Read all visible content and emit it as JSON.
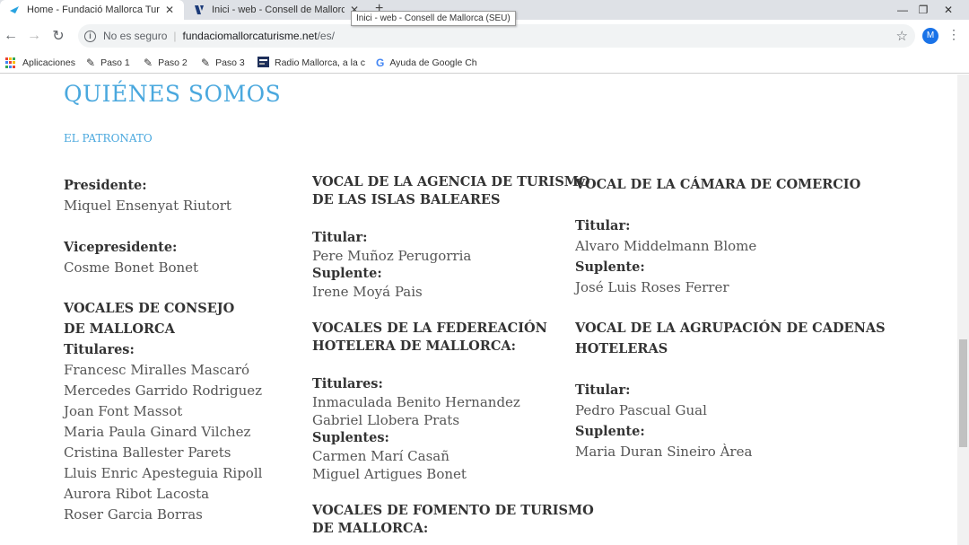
{
  "browser": {
    "tabs": [
      {
        "title": "Home - Fundació Mallorca Turisme",
        "close": "✕"
      },
      {
        "title": "Inici - web - Consell de Mallorca",
        "close": "✕"
      }
    ],
    "tooltip": "Inici - web - Consell de Mallorca (SEU)",
    "new_tab": "+",
    "window_controls": {
      "minimize": "—",
      "restore": "❐",
      "close": "✕"
    },
    "nav": {
      "back": "←",
      "forward": "→",
      "reload": "↻"
    },
    "address": {
      "security_label": "No es seguro",
      "separator": "|",
      "host": "fundaciomallorcaturisme.net",
      "path": "/es/"
    },
    "bookmark_star": "☆",
    "avatar_letter": "M",
    "menu": "⋮",
    "bookmarks": [
      {
        "label": "Aplicaciones",
        "icon": "apps-grid-icon"
      },
      {
        "label": "Paso 1",
        "icon": "pencil-icon"
      },
      {
        "label": "Paso 2",
        "icon": "pencil-icon"
      },
      {
        "label": "Paso 3",
        "icon": "pencil-icon"
      },
      {
        "label": "Radio Mallorca, a la c",
        "icon": "radio-icon"
      },
      {
        "label": "Ayuda de Google Ch",
        "icon": "google-icon"
      }
    ]
  },
  "page": {
    "heading": "QUIÉNES SOMOS",
    "subheading": "EL PATRONATO",
    "col1": {
      "president_label": "Presidente:",
      "president": "Miquel Ensenyat Riutort",
      "vicepresident_label": "Vicepresidente:",
      "vicepresident": "Cosme Bonet Bonet",
      "consell_heading_1": "VOCALES DE CONSEJO",
      "consell_heading_2": "DE MALLORCA",
      "titulares_label": "Titulares:",
      "titulares": [
        "Francesc Miralles Mascaró",
        "Mercedes Garrido Rodriguez",
        "Joan Font Massot",
        "Maria Paula Ginard Vilchez",
        "Cristina Ballester Parets",
        "Lluis Enric Apesteguia Ripoll",
        "Aurora Ribot Lacosta",
        "Roser Garcia Borras"
      ]
    },
    "col2": {
      "agencia_heading_1": "VOCAL DE LA AGENCIA DE TURISMO",
      "agencia_heading_2": "DE LAS ISLAS BALEARES",
      "titular_label": "Titular:",
      "titular": "Pere Muñoz Perugorria",
      "suplente_label": "Suplente:",
      "suplente": "Irene Moyá Pais",
      "fed_heading_1": "VOCALES DE LA FEDEREACIÓN",
      "fed_heading_2": "HOTELERA DE MALLORCA:",
      "fed_titulares_label": "Titulares:",
      "fed_titulares": [
        "Inmaculada Benito Hernandez",
        "Gabriel Llobera Prats"
      ],
      "fed_suplentes_label": "Suplentes:",
      "fed_suplentes": [
        "Carmen Marí Casañ",
        "Miguel Artigues Bonet"
      ],
      "fomento_heading_1": "VOCALES DE FOMENTO DE TURISMO",
      "fomento_heading_2": "DE MALLORCA:"
    },
    "col3": {
      "camara_heading": "VOCAL DE LA CÁMARA DE COMERCIO",
      "titular_label": "Titular:",
      "titular": "Alvaro Middelmann Blome",
      "suplente_label": "Suplente:",
      "suplente": "José Luis Roses Ferrer",
      "agrup_heading_1": "VOCAL DE LA AGRUPACIÓN DE CADENAS",
      "agrup_heading_2": "HOTELERAS",
      "agrup_titular_label": "Titular:",
      "agrup_titular": "Pedro Pascual Gual",
      "agrup_suplente_label": "Suplente:",
      "agrup_suplente": "Maria Duran Sineiro Àrea"
    }
  },
  "colors": {
    "accent": "#4aa8de",
    "text": "#555555",
    "label": "#333333"
  }
}
